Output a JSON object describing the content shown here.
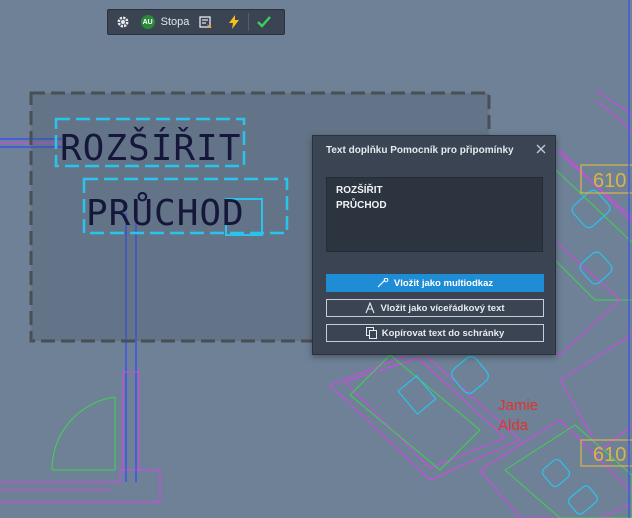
{
  "toolbar": {
    "settings_icon": "gear-icon",
    "avatar_initials": "AU",
    "user_label": "Stopa",
    "items": [
      "markup-import-icon",
      "lightning-icon",
      "checkmark-icon"
    ]
  },
  "markup": {
    "line1": "ROZŠÍŘIT",
    "line2": "PRŮCHOD"
  },
  "drawing": {
    "tag_top": "610",
    "tag_bottom": "610",
    "annotation_line1": "Jamie",
    "annotation_line2": "Alda"
  },
  "panel": {
    "title": "Text doplňku Pomocník pro připomínky",
    "text_line1": "ROZŠÍŘIT",
    "text_line2": "PRŮCHOD",
    "btn_multileader": "Vložit jako multiodkaz",
    "btn_mtext": "Vložit jako víceřádkový text",
    "btn_copy": "Kopírovat text do schránky"
  },
  "colors": {
    "canvas_bg": "#6e8196",
    "accent": "#1e8dd6",
    "panel_bg": "#3b4453",
    "magenta": "#d844e8",
    "cyan": "#29c4ec",
    "green": "#3fd34f",
    "blue": "#2f47ff",
    "yellow": "#d9b44a",
    "annotation_red": "#e0322e"
  }
}
